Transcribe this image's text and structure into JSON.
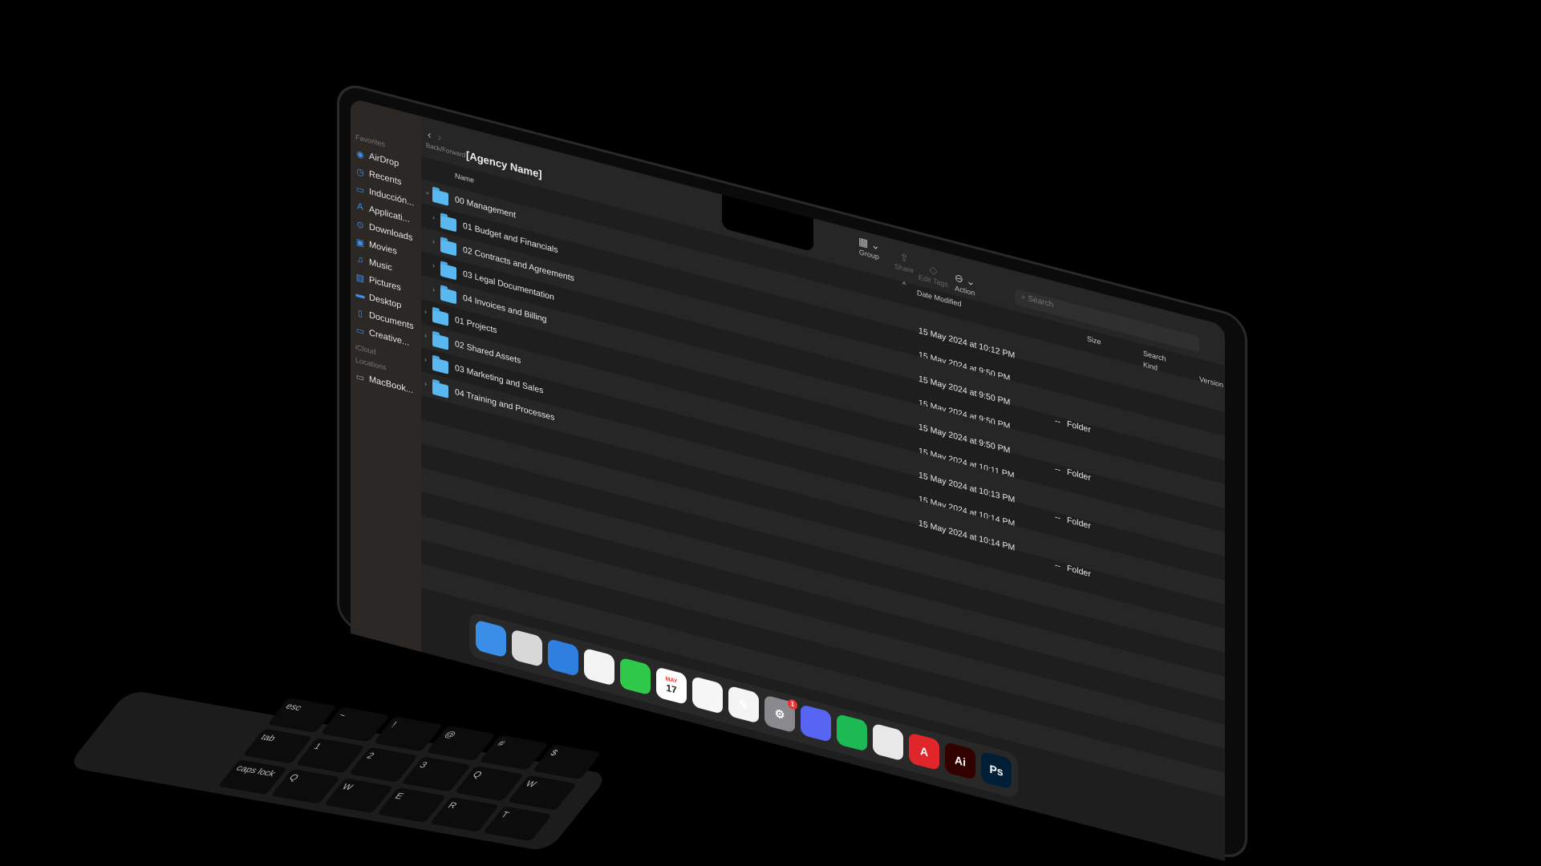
{
  "window": {
    "title": "[Agency Name]",
    "nav_label": "Back/Forward"
  },
  "sidebar": {
    "favorites_label": "Favorites",
    "items": [
      {
        "label": "AirDrop",
        "icon": "airdrop-icon"
      },
      {
        "label": "Recents",
        "icon": "clock-icon"
      },
      {
        "label": "Inducción...",
        "icon": "folder-icon"
      },
      {
        "label": "Applicati...",
        "icon": "applications-icon"
      },
      {
        "label": "Downloads",
        "icon": "download-icon"
      },
      {
        "label": "Movies",
        "icon": "film-icon"
      },
      {
        "label": "Music",
        "icon": "music-icon"
      },
      {
        "label": "Pictures",
        "icon": "pictures-icon"
      },
      {
        "label": "Desktop",
        "icon": "desktop-icon"
      },
      {
        "label": "Documents",
        "icon": "document-icon"
      },
      {
        "label": "Creative...",
        "icon": "folder-icon"
      }
    ],
    "icloud_label": "iCloud",
    "locations_label": "Locations",
    "locations": [
      {
        "label": "MacBook...",
        "icon": "laptop-icon"
      }
    ]
  },
  "toolbar": {
    "group": "Group",
    "share": "Share",
    "edit_tags": "Edit Tags",
    "action": "Action",
    "search_placeholder": "Search"
  },
  "columns": {
    "name": "Name",
    "date": "Date Modified",
    "size": "Size",
    "search": "Search",
    "kind": "Kind",
    "version": "Version"
  },
  "rows": [
    {
      "name": "00 Management",
      "level": 0,
      "expanded": true,
      "date": "15 May 2024 at 10:12 PM",
      "size": "",
      "kind": ""
    },
    {
      "name": "01 Budget and Financials",
      "level": 1,
      "date": "15 May 2024 at 9:50 PM",
      "size": "--",
      "kind": "Folder"
    },
    {
      "name": "02 Contracts and Agreements",
      "level": 1,
      "date": "15 May 2024 at 9:50 PM",
      "size": "--",
      "kind": "Folder"
    },
    {
      "name": "03 Legal Documentation",
      "level": 1,
      "date": "15 May 2024 at 9:50 PM",
      "size": "--",
      "kind": "Folder"
    },
    {
      "name": "04 Invoices and Billing",
      "level": 1,
      "date": "15 May 2024 at 9:50 PM",
      "size": "--",
      "kind": "Folder"
    },
    {
      "name": "01 Projects",
      "level": 0,
      "date": "15 May 2024 at 10:11 PM",
      "size": "--",
      "kind": "Folder"
    },
    {
      "name": "02 Shared Assets",
      "level": 0,
      "date": "15 May 2024 at 10:13 PM",
      "size": "--",
      "kind": "Folder"
    },
    {
      "name": "03 Marketing and Sales",
      "level": 0,
      "date": "15 May 2024 at 10:14 PM",
      "size": "--",
      "kind": "Folder"
    },
    {
      "name": "04 Training and Processes",
      "level": 0,
      "date": "15 May 2024 at 10:14 PM",
      "size": "--",
      "kind": "Folder"
    }
  ],
  "extra_row": {
    "size": "--",
    "kind": "Folder"
  },
  "dock": [
    {
      "name": "finder",
      "label": "",
      "color": "#3a8ee8"
    },
    {
      "name": "launchpad",
      "label": "",
      "color": "#d8d8d8"
    },
    {
      "name": "safari",
      "label": "",
      "color": "#2f7fe0"
    },
    {
      "name": "photos",
      "label": "",
      "color": "#f3f3f3"
    },
    {
      "name": "facetime",
      "label": "",
      "color": "#2fc84a"
    },
    {
      "name": "calendar",
      "label": "17",
      "month": "MAY",
      "color": "#ffffff"
    },
    {
      "name": "reminders",
      "label": "",
      "color": "#f7f7f7"
    },
    {
      "name": "pages",
      "label": "✎",
      "color": "#f4f4f4"
    },
    {
      "name": "system-settings",
      "label": "⚙",
      "color": "#8a8a8e",
      "badge": "1"
    },
    {
      "name": "discord",
      "label": "",
      "color": "#5865f2"
    },
    {
      "name": "spotify",
      "label": "",
      "color": "#1db954"
    },
    {
      "name": "chrome",
      "label": "",
      "color": "#e8e8e8"
    },
    {
      "name": "acrobat",
      "label": "A",
      "color": "#e0252b"
    },
    {
      "name": "illustrator",
      "label": "Ai",
      "color": "#330000"
    },
    {
      "name": "photoshop",
      "label": "Ps",
      "color": "#001e36"
    }
  ],
  "keyboard": [
    "esc",
    "~",
    "!",
    "@",
    "#",
    "$",
    "tab",
    "1",
    "2",
    "3",
    "Q",
    "W",
    "caps lock",
    "Q",
    "W",
    "E",
    "R",
    "T"
  ]
}
